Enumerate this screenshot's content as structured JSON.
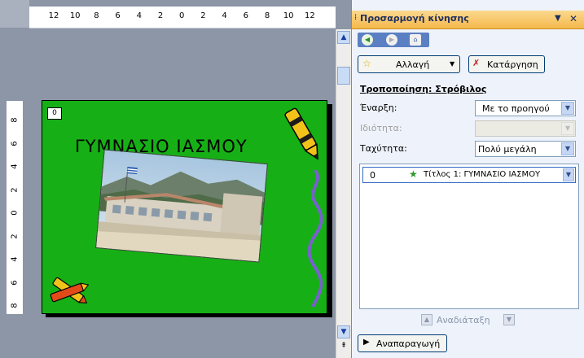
{
  "ruler": {
    "horizontal_labels": [
      "12",
      "10",
      "8",
      "6",
      "4",
      "2",
      "0",
      "2",
      "4",
      "6",
      "8",
      "10",
      "12"
    ],
    "vertical_labels": [
      "8",
      "6",
      "4",
      "2",
      "0",
      "2",
      "4",
      "6",
      "8"
    ]
  },
  "slide": {
    "title": "ΓΥΜΝΑΣΙΟ  ΙΑΣΜΟΥ",
    "animation_tag": "0",
    "background_color": "#16b016"
  },
  "task_pane": {
    "title": "Προσαρμογή κίνησης",
    "dropdown_arrow": "▼",
    "close": "✕",
    "nav": {
      "back": "◀",
      "forward": "▶",
      "home": "⌂"
    },
    "change_button": "Αλλαγή",
    "remove_button": "Κατάργηση",
    "modify_label": "Τροποποίηση: Στρόβιλος",
    "start_label": "Έναρξη:",
    "start_value": "Με το προηγού",
    "property_label": "Ιδιότητα:",
    "property_value": "",
    "speed_label": "Ταχύτητα:",
    "speed_value": "Πολύ μεγάλη",
    "list_item": {
      "number": "0",
      "text": "Τίτλος 1: ΓΥΜΝΑΣΙΟ  ΙΑΣΜΟΥ"
    },
    "reorder_label": "Αναδιάταξη",
    "play_button": "Αναπαραγωγή",
    "accent_color": "#f5b84c"
  }
}
